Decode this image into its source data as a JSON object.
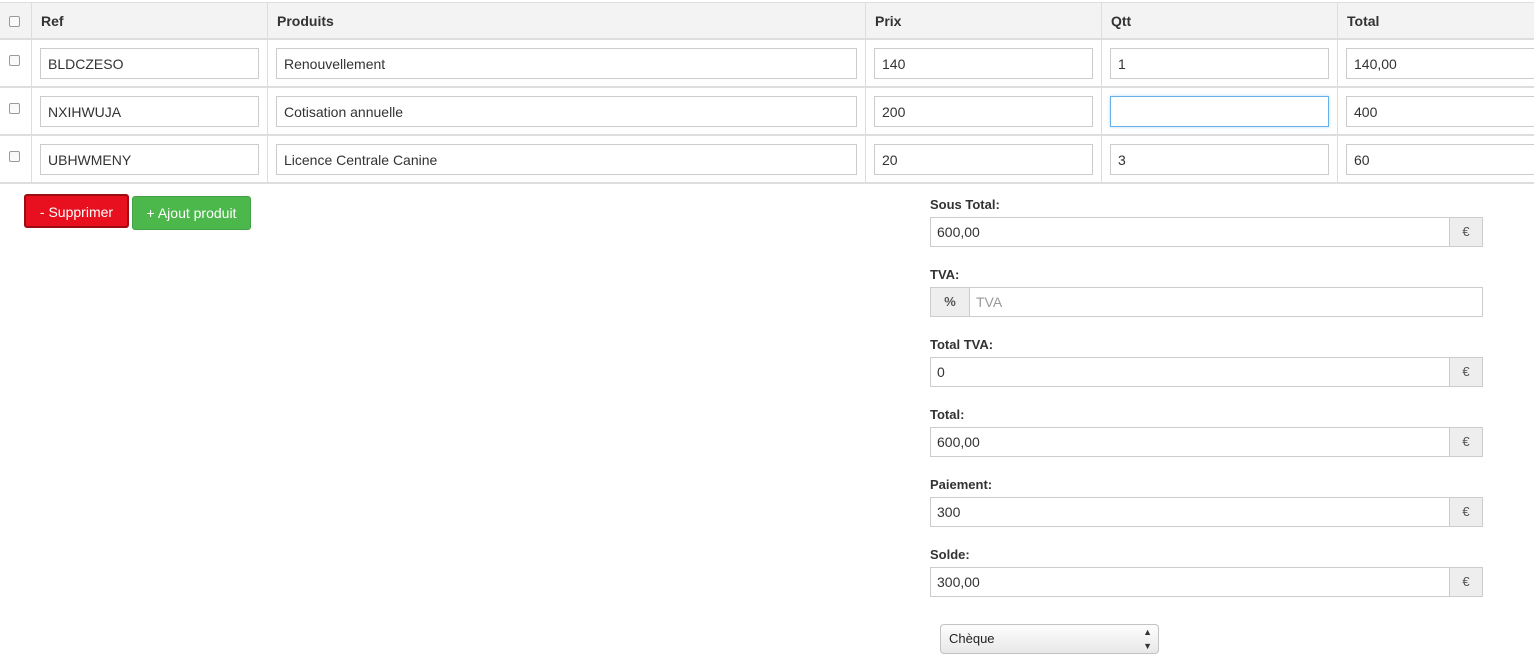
{
  "table": {
    "headers": [
      "Ref",
      "Produits",
      "Prix",
      "Qtt",
      "Total"
    ],
    "rows": [
      {
        "ref": "BLDCZESO",
        "produit": "Renouvellement",
        "prix": "140",
        "qtt": "1",
        "total": "140,00"
      },
      {
        "ref": "NXIHWUJA",
        "produit": "Cotisation annuelle",
        "prix": "200",
        "qtt": "",
        "total": "400"
      },
      {
        "ref": "UBHWMENY",
        "produit": "Licence Centrale Canine",
        "prix": "20",
        "qtt": "3",
        "total": "60"
      }
    ]
  },
  "buttons": {
    "delete": "- Supprimer",
    "add": "+ Ajout produit"
  },
  "summary": {
    "sous_total": {
      "label": "Sous Total:",
      "value": "600,00",
      "addon": "€"
    },
    "tva": {
      "label": "TVA:",
      "value": "",
      "placeholder": "TVA",
      "addon": "%"
    },
    "total_tva": {
      "label": "Total TVA:",
      "value": "0",
      "addon": "€"
    },
    "total": {
      "label": "Total:",
      "value": "600,00",
      "addon": "€"
    },
    "paiement": {
      "label": "Paiement:",
      "value": "300",
      "addon": "€"
    },
    "solde": {
      "label": "Solde:",
      "value": "300,00",
      "addon": "€"
    }
  },
  "payment_method": {
    "selected": "Chèque",
    "arrow_icon": "select-arrows-icon"
  },
  "colors": {
    "danger": "#e8101e",
    "success": "#4cb84c",
    "focus": "#66afe9"
  }
}
